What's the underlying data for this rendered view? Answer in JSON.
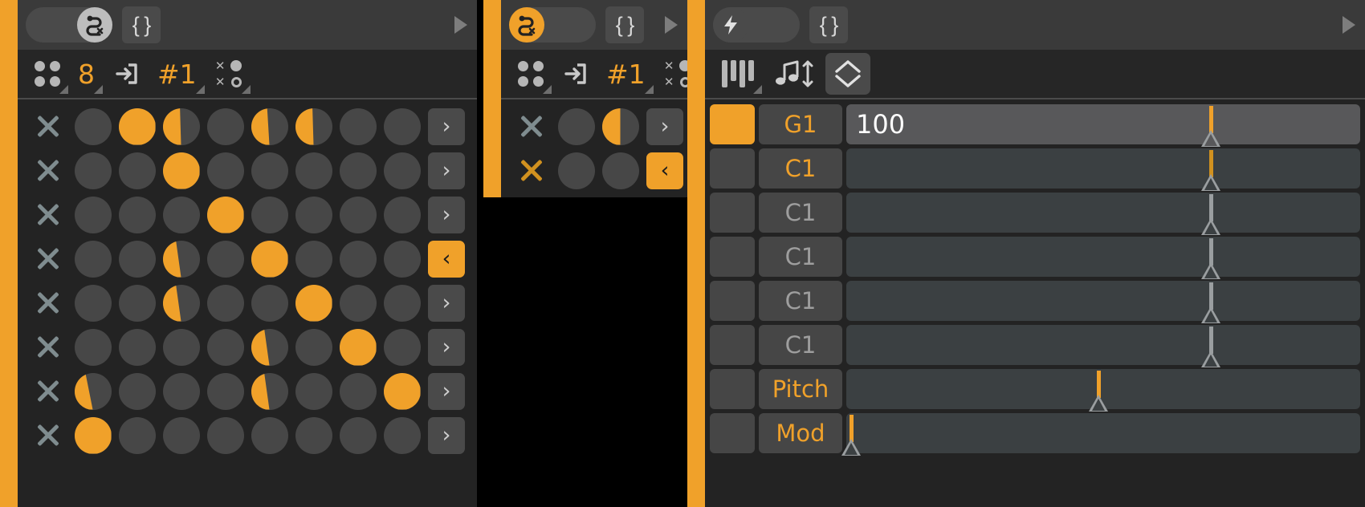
{
  "app": {
    "background": "#000000",
    "accent": "#f0a12a",
    "panel_bg": "#232323"
  },
  "panels": {
    "sequencer": {
      "name": "euclidean-sequencer-panel",
      "titlebar": {
        "toggle_name": "snake-mode-toggle",
        "toggle_state": "off",
        "toggle_icon": "snake-x-icon",
        "braces_label": "{ }",
        "braces_name": "curly-braces-button",
        "play_icon": "play-triangle-icon"
      },
      "toolbar": {
        "items": [
          {
            "name": "four-dots-icon",
            "label": "",
            "icon": "four-dots-icon",
            "type": "icon"
          },
          {
            "name": "step-count",
            "label": "8",
            "icon": "",
            "type": "number"
          },
          {
            "name": "input-route-icon",
            "label": "",
            "icon": "arrow-into-box-icon",
            "type": "icon"
          },
          {
            "name": "channel-number",
            "label": "#1",
            "icon": "",
            "type": "number"
          },
          {
            "name": "randomize-icon",
            "label": "",
            "icon": "x-o-dots-icon",
            "type": "icon"
          }
        ]
      },
      "rows": [
        {
          "mute_on": false,
          "steps": [
            0,
            100,
            45,
            0,
            40,
            45,
            0,
            0
          ],
          "arrow": "›",
          "arrow_active": false
        },
        {
          "mute_on": false,
          "steps": [
            0,
            0,
            100,
            0,
            0,
            0,
            0,
            0
          ],
          "arrow": "›",
          "arrow_active": false
        },
        {
          "mute_on": false,
          "steps": [
            0,
            0,
            0,
            100,
            0,
            0,
            0,
            0
          ],
          "arrow": "›",
          "arrow_active": false
        },
        {
          "mute_on": false,
          "steps": [
            0,
            0,
            35,
            0,
            100,
            0,
            0,
            0
          ],
          "arrow": "‹",
          "arrow_active": true
        },
        {
          "mute_on": false,
          "steps": [
            0,
            0,
            35,
            0,
            0,
            100,
            0,
            0
          ],
          "arrow": "›",
          "arrow_active": false
        },
        {
          "mute_on": false,
          "steps": [
            0,
            0,
            0,
            0,
            35,
            0,
            100,
            0
          ],
          "arrow": "›",
          "arrow_active": false
        },
        {
          "mute_on": false,
          "steps": [
            30,
            0,
            0,
            0,
            35,
            0,
            0,
            100
          ],
          "arrow": "›",
          "arrow_active": false
        },
        {
          "mute_on": false,
          "steps": [
            100,
            0,
            0,
            0,
            0,
            0,
            0,
            0
          ],
          "arrow": "›",
          "arrow_active": false
        }
      ]
    },
    "sequencer2": {
      "name": "secondary-sequencer-panel",
      "titlebar": {
        "toggle_name": "snake-mode-toggle",
        "toggle_state": "on",
        "toggle_icon": "snake-x-icon",
        "braces_label": "{ }",
        "braces_name": "curly-braces-button",
        "play_icon": "play-triangle-icon"
      },
      "toolbar": {
        "items": [
          {
            "name": "four-dots-icon",
            "label": "",
            "icon": "four-dots-icon",
            "type": "icon"
          },
          {
            "name": "input-route-icon",
            "label": "",
            "icon": "arrow-into-box-icon",
            "type": "icon"
          },
          {
            "name": "channel-number",
            "label": "#1",
            "icon": "",
            "type": "number"
          },
          {
            "name": "randomize-icon",
            "label": "",
            "icon": "x-o-dots-icon",
            "type": "icon"
          }
        ]
      },
      "rows": [
        {
          "mute_on": false,
          "steps": [
            0,
            50
          ],
          "arrow": "›",
          "arrow_active": false
        },
        {
          "mute_on": true,
          "steps": [
            0,
            0
          ],
          "arrow": "‹",
          "arrow_active": true
        }
      ]
    },
    "cc": {
      "name": "cc-lane-panel",
      "titlebar": {
        "toggle_name": "lightning-mode-toggle",
        "toggle_state": "off",
        "toggle_icon": "lightning-bolt-icon",
        "braces_label": "{ }",
        "braces_name": "curly-braces-button",
        "play_icon": "play-triangle-icon"
      },
      "toolbar": {
        "items": [
          {
            "name": "piano-keys-icon",
            "label": "",
            "icon": "piano-keys-icon",
            "type": "icon"
          },
          {
            "name": "note-transpose-icon",
            "label": "",
            "icon": "note-arrows-icon",
            "type": "icon"
          },
          {
            "name": "range-diamond-icon",
            "label": "",
            "icon": "diamond-updown-icon",
            "type": "icon",
            "boxed": true
          }
        ]
      },
      "rows": [
        {
          "name": "cc-row-g1",
          "enabled": true,
          "label": "G1",
          "label_hot": true,
          "value": "100",
          "marker_pct": 71,
          "marker_tone": "hot",
          "active": true
        },
        {
          "name": "cc-row-c1-1",
          "enabled": false,
          "label": "C1",
          "label_hot": true,
          "value": "",
          "marker_pct": 71,
          "marker_tone": "warm",
          "active": false
        },
        {
          "name": "cc-row-c1-2",
          "enabled": false,
          "label": "C1",
          "label_hot": false,
          "value": "",
          "marker_pct": 71,
          "marker_tone": "cool",
          "active": false
        },
        {
          "name": "cc-row-c1-3",
          "enabled": false,
          "label": "C1",
          "label_hot": false,
          "value": "",
          "marker_pct": 71,
          "marker_tone": "cool",
          "active": false
        },
        {
          "name": "cc-row-c1-4",
          "enabled": false,
          "label": "C1",
          "label_hot": false,
          "value": "",
          "marker_pct": 71,
          "marker_tone": "cool",
          "active": false
        },
        {
          "name": "cc-row-c1-5",
          "enabled": false,
          "label": "C1",
          "label_hot": false,
          "value": "",
          "marker_pct": 71,
          "marker_tone": "cool",
          "active": false
        },
        {
          "name": "cc-row-pitch",
          "enabled": false,
          "label": "Pitch",
          "label_hot": true,
          "value": "",
          "marker_pct": 49,
          "marker_tone": "hot",
          "active": false
        },
        {
          "name": "cc-row-mod",
          "enabled": false,
          "label": "Mod",
          "label_hot": true,
          "value": "",
          "marker_pct": 1,
          "marker_tone": "hot",
          "active": false
        }
      ]
    }
  }
}
